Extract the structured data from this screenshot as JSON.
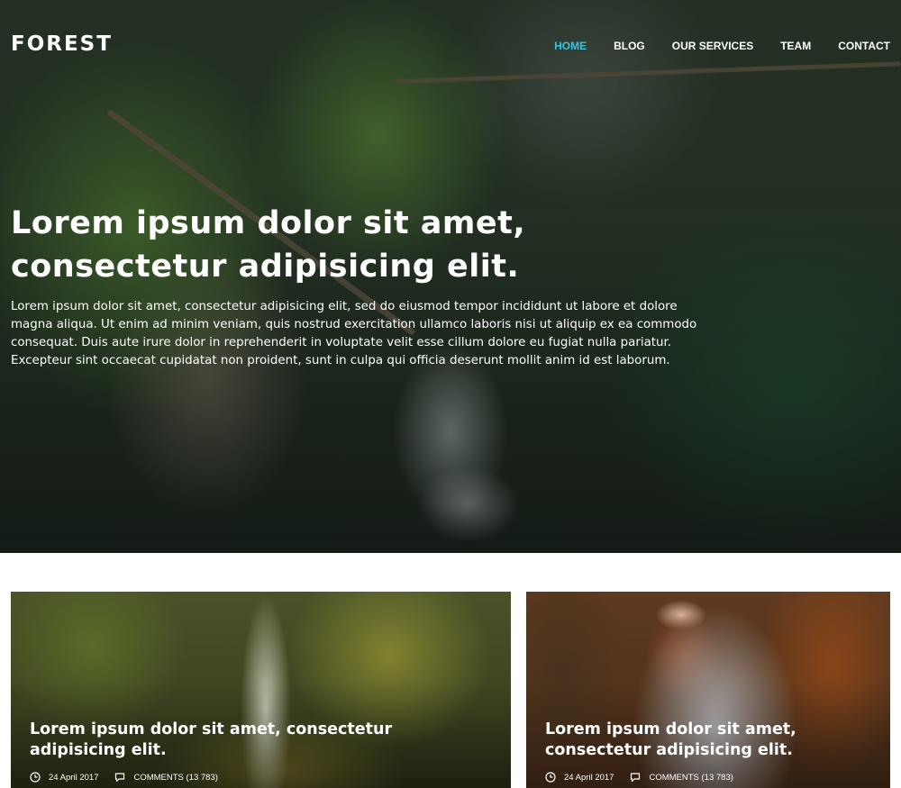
{
  "brand": {
    "name": "FOREST"
  },
  "nav": {
    "items": [
      {
        "label": "HOME",
        "active": true
      },
      {
        "label": "BLOG"
      },
      {
        "label": "OUR SERVICES"
      },
      {
        "label": "TEAM"
      },
      {
        "label": "CONTACT"
      }
    ],
    "active_color": "#35c6dc"
  },
  "hero": {
    "title": "Lorem ipsum dolor sit amet, consectetur adipisicing elit.",
    "text": "Lorem ipsum dolor sit amet, consectetur adipisicing elit, sed do eiusmod tempor incididunt ut labore et dolore magna aliqua. Ut enim ad minim veniam, quis nostrud exercitation ullamco laboris nisi ut aliquip ex ea commodo consequat. Duis aute irure dolor in reprehenderit in voluptate velit esse cillum dolore eu fugiat nulla pariatur. Excepteur sint occaecat cupidatat non proident, sunt in culpa qui officia deserunt mollit anim id est laborum."
  },
  "cards": [
    {
      "title": "Lorem ipsum dolor sit amet, consectetur adipisicing elit.",
      "date": "24 April 2017",
      "comments": "COMMENTS (13 783)",
      "date_icon": "clock-icon",
      "comments_icon": "comment-icon"
    },
    {
      "title": "Lorem ipsum dolor sit amet, consectetur adipisicing elit.",
      "date": "24 April 2017",
      "comments": "COMMENTS (13 783)",
      "date_icon": "clock-icon",
      "comments_icon": "comment-icon"
    }
  ]
}
